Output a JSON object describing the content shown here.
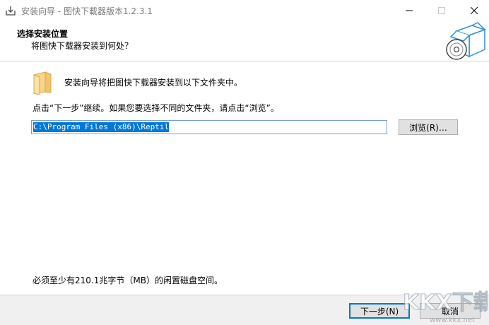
{
  "window": {
    "title": "安装向导 - 图快下載器版本1.2.3.1"
  },
  "header": {
    "title": "选择安装位置",
    "subtitle": "将图快下载器安装到何处？"
  },
  "body": {
    "folder_message": "安装向导将把图快下载器安装到以下文件夹中。",
    "instruction": "点击“下一步”继续。如果您要选择不同的文件夹，请点击“浏览”。",
    "install_path": "C:\\Program Files (x86)\\Reptil",
    "browse_label": "浏览(R)…",
    "space_required": "必须至少有210.1兆字节（MB）的闲置磁盘空间。"
  },
  "footer": {
    "next_label": "下一步(N)",
    "cancel_label": "取消"
  },
  "watermark": {
    "brand": "KKX下载",
    "url": "www.kkx.net"
  },
  "colors": {
    "selection": "#0078d7",
    "folder": "#f7d58b",
    "footer_bg": "#f0f0f0"
  },
  "icons": {
    "app": "download-box-icon",
    "minimize": "minimize-icon",
    "maximize": "maximize-icon",
    "close": "close-icon",
    "header_image": "software-box-cd-icon",
    "folder": "folder-icon"
  }
}
